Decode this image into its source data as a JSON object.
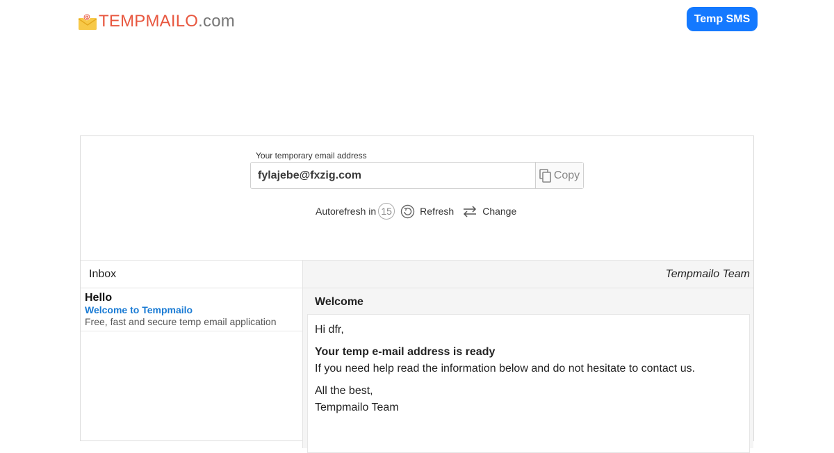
{
  "header": {
    "logo": {
      "part_temp": "TEMP",
      "part_mailo": "MAILO",
      "part_com": ".com"
    },
    "temp_sms_label": "Temp SMS"
  },
  "email_box": {
    "label": "Your temporary email address",
    "address": "fylajebe@fxzig.com",
    "copy_label": "Copy"
  },
  "controls": {
    "autorefresh_label": "Autorefresh in",
    "countdown": "15",
    "refresh_label": "Refresh",
    "change_label": "Change"
  },
  "inbox": {
    "title": "Inbox",
    "items": [
      {
        "from": "Hello",
        "subject": "Welcome to Tempmailo",
        "preview": "Free, fast and secure temp email application"
      }
    ]
  },
  "reader": {
    "sender": "Tempmailo Team",
    "subject": "Welcome",
    "greeting": "Hi dfr,",
    "headline": "Your temp e-mail address is ready",
    "body": "If you need help read the information below and do not hesitate to contact us.",
    "signoff": "All the best,",
    "signature": "Tempmailo Team"
  },
  "colors": {
    "accent_button": "#1479ff",
    "logo_orange": "#e8573f",
    "subject_link": "#1a7bd4"
  },
  "icons": {
    "logo": "envelope-at-icon",
    "copy": "copy-icon",
    "refresh": "refresh-icon",
    "change": "swap-arrows-icon"
  }
}
